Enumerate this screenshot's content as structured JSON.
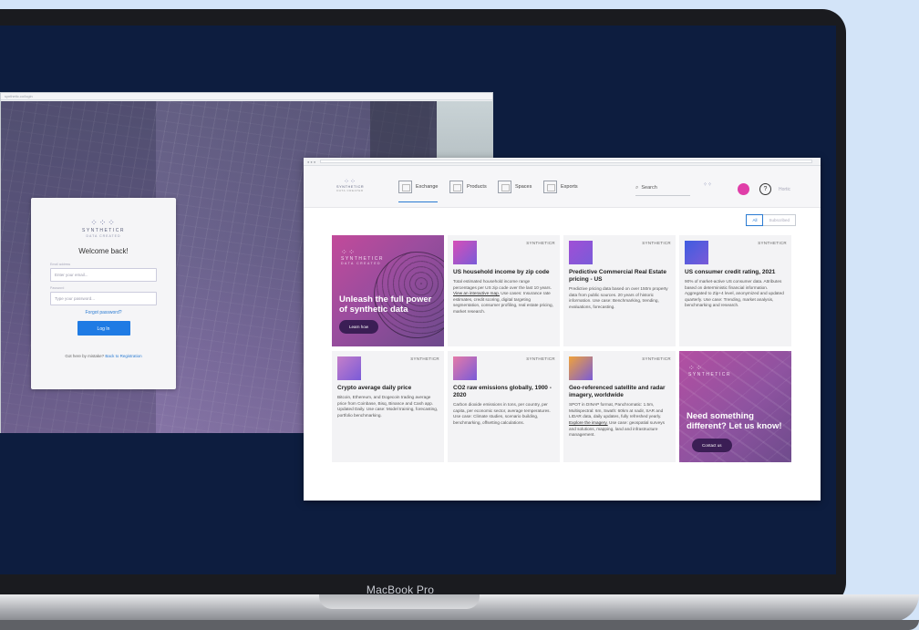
{
  "device": {
    "label": "MacBook Pro"
  },
  "login_window": {
    "url": "synthetic.co/login",
    "brand": "SYNTHETICR",
    "brand_sub": "DATA CREATED",
    "welcome": "Welcome back!",
    "email_label": "Email address",
    "email_placeholder": "Enter your email...",
    "password_label": "Password",
    "password_placeholder": "Type your password...",
    "forgot": "Forgot password?",
    "login_button": "Log In",
    "footer_prefix": "Got here by mistake?",
    "footer_link": "Back to Registration"
  },
  "app": {
    "brand": "SYNTHETICR",
    "brand_sub": "DATA CREATED",
    "nav": [
      {
        "label": "Exchange",
        "icon": "exchange-icon"
      },
      {
        "label": "Products",
        "icon": "products-icon"
      },
      {
        "label": "Spaces",
        "icon": "spaces-icon"
      },
      {
        "label": "Exports",
        "icon": "exports-icon"
      }
    ],
    "search_label": "Search",
    "user_label": "Hortic",
    "filters": {
      "all": "All",
      "subscribed": "Subscribed"
    },
    "accent": "#2a7bd2",
    "promo1": {
      "brand": "SYNTHETICR",
      "brand_sub": "DATA CREATED",
      "title": "Unleash the full power of synthetic data",
      "button": "Learn how"
    },
    "promo2": {
      "brand": "SYNTHETICR",
      "title": "Need something different? Let us know!",
      "button": "Contact us"
    },
    "cards": [
      {
        "vendor": "SYNTHETICR",
        "title": "US household income by zip code",
        "desc": "Total estimated household income range percentages per US zip code over the last 10 years.",
        "link": "View an interactive map.",
        "desc2": "Use cases: Insurance rate estimates, credit scoring, digital targeting segmentation, consumer profiling, real estate pricing, market research.",
        "thumb": "#d64fb7"
      },
      {
        "vendor": "SYNTHETICR",
        "title": "Predictive Commercial Real Estate pricing - US",
        "desc": "Predictive pricing data based on over 150m property data from public sources. 20 years of historic information.",
        "link": "",
        "desc2": "Use case: Benchmarking, trending, evaluations, forecasting.",
        "thumb": "#a04fd6"
      },
      {
        "vendor": "SYNTHETICR",
        "title": "US consumer credit rating, 2021",
        "desc": "90% of market-active US consumer data. Attributes based on deterministic financial information. Aggregated to Zip+4 level, anonymized and updated quarterly.",
        "link": "",
        "desc2": "Use case: Trending, market analysis, benchmarking and research.",
        "thumb": "#3f5ce0"
      },
      {
        "vendor": "SYNTHETICR",
        "title": "Crypto average daily price",
        "desc": "Bitcoin, Ethereum, and Dogecoin trading average price from Coinbase, Bisq, Binance and Cash app. Updated Daily.",
        "link": "",
        "desc2": "Use case: Model training, forecasting, portfolio benchmarking.",
        "thumb": "#c57fc9"
      },
      {
        "vendor": "SYNTHETICR",
        "title": "CO2 raw emissions globally, 1900 - 2020",
        "desc": "Carbon dioxide emissions in tons, per country, per capita, per economic sector, average temperatures.",
        "link": "",
        "desc2": "Use case: Climate studies, scenario building, benchmarking, offsetting calculations.",
        "thumb": "#e57aa8"
      },
      {
        "vendor": "SYNTHETICR",
        "title": "Geo-referenced satellite and radar imagery, worldwide",
        "desc": "SPOT in DINAP format, Panchromatic: 1.5m, Multispectral: 6m, Swath: 60km at nadir, SAR and LIDAR data, daily updates, fully refreshed yearly.",
        "link": "Explore the imagery.",
        "desc2": "Use case: geospatial surveys and solutions, mapping, land and infrastructure management.",
        "thumb": "#f0a23a"
      }
    ]
  }
}
